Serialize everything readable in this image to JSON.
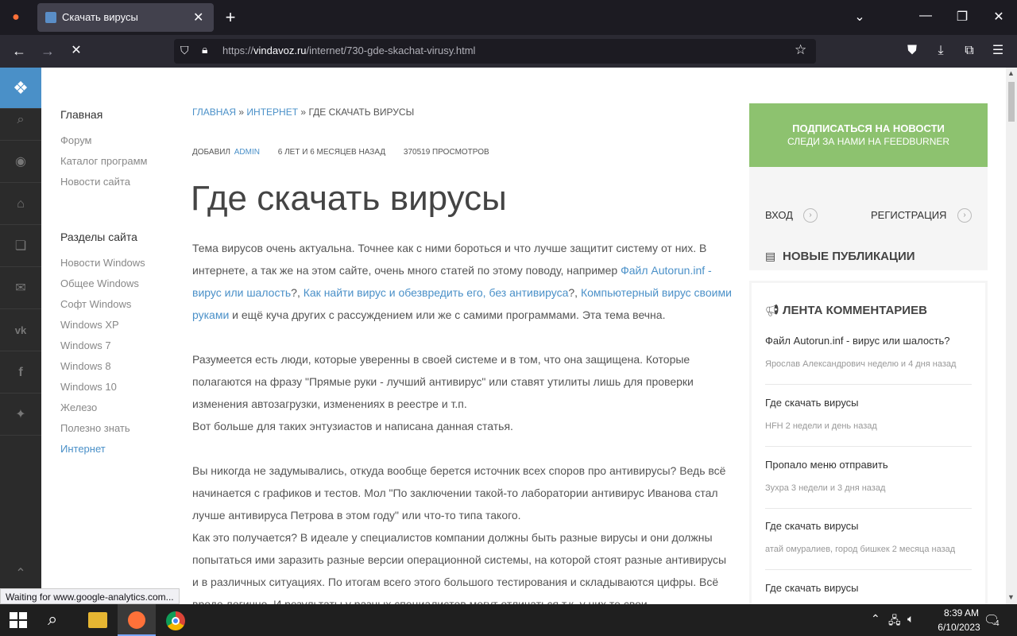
{
  "browser": {
    "tab_title": "Скачать вирусы",
    "url_domain": "vindavoz.ru",
    "url_prefix": "https://",
    "url_path": "/internet/730-gde-skachat-virusy.html",
    "status": "Waiting for www.google-analytics.com..."
  },
  "left_menu": {
    "home": "Главная",
    "items": [
      "Форум",
      "Каталог программ",
      "Новости сайта"
    ],
    "sections_title": "Разделы сайта",
    "sections": [
      "Новости Windows",
      "Общее Windows",
      "Софт Windows",
      "Windows XP",
      "Windows 7",
      "Windows 8",
      "Windows 10",
      "Железо",
      "Полезно знать",
      "Интернет"
    ]
  },
  "breadcrumb": {
    "home": "ГЛАВНАЯ",
    "sep": "»",
    "section": "ИНТЕРНЕТ",
    "current": "ГДЕ СКАЧАТЬ ВИРУСЫ"
  },
  "meta": {
    "added": "ДОБАВИЛ",
    "author": "ADMIN",
    "time": "6 ЛЕТ И 6 МЕСЯЦЕВ НАЗАД",
    "views": "370519 ПРОСМОТРОВ"
  },
  "article": {
    "title": "Где скачать вирусы",
    "p1_a": "Тема вирусов очень актуальна. Точнее как с ними бороться и что лучше защитит систему от них. В интернете, а так же на этом сайте, очень много статей по этому поводу, например ",
    "p1_link1": "Файл Autorun.inf - вирус или шалость",
    "p1_b": "?, ",
    "p1_link2": "Как найти вирус и обезвредить его, без антивируса",
    "p1_c": "?, ",
    "p1_link3": "Компьютерный вирус своими руками",
    "p1_d": " и ещё куча других с рассуждением или же с самими программами. Эта тема вечна.",
    "p2": "Разумеется есть люди, которые уверенны в своей системе и в том, что она защищена. Которые полагаются на фразу \"Прямые руки - лучший антивирус\" или ставят утилиты лишь для проверки изменения автозагрузки, изменениях в реестре и т.п.",
    "p3": "Вот больше для таких энтузиастов и написана данная статья.",
    "p4": "Вы никогда не задумывались, откуда вообще берется источник всех споров про антивирусы? Ведь всё начинается с графиков и тестов. Мол \"По заключении такой-то лаборатории антивирус Иванова стал лучше антивируса Петрова в этом году\" или что-то типа такого.",
    "p5": "Как это получается? В идеале у специалистов компании должны быть разные вирусы и они должны попытаться ими заразить разные версии операционной системы, на которой стоят разные антивирусы и в различных ситуациях. По итогам всего этого большого тестирования и складываются цифры. Всё вроде логично. И результаты у разных специалистов могут отличаться т.к. у них те свои"
  },
  "sidebar": {
    "subscribe_title": "ПОДПИСАТЬСЯ НА НОВОСТИ",
    "subscribe_sub": "СЛЕДИ ЗА НАМИ НА FEEDBURNER",
    "subscribe_color": "#8dc26f",
    "login": "ВХОД",
    "register": "РЕГИСТРАЦИЯ",
    "new_pubs": "НОВЫЕ ПУБЛИКАЦИИ",
    "comments_title": "ЛЕНТА КОММЕНТАРИЕВ",
    "comments": [
      {
        "title": "Файл Autorun.inf - вирус или шалость?",
        "meta": "Ярослав Александрович неделю и 4 дня назад"
      },
      {
        "title": "Где скачать вирусы",
        "meta": "HFH 2 недели и день назад"
      },
      {
        "title": "Пропало меню отправить",
        "meta": "Зухра 3 недели и 3 дня назад"
      },
      {
        "title": "Где скачать вирусы",
        "meta": "атай омуралиев, город бишкек 2 месяца назад"
      },
      {
        "title": "Где скачать вирусы",
        "meta": ""
      }
    ]
  },
  "taskbar": {
    "time": "8:39 AM",
    "date": "6/10/2023",
    "notif_count": "4"
  }
}
